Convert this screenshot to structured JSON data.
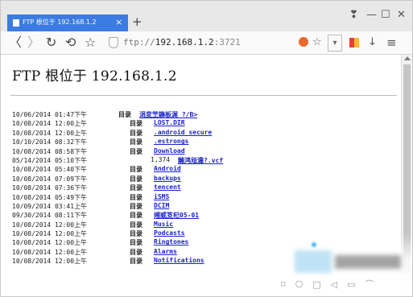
{
  "tab": {
    "title": "FTP 根位于 192.168.1.2",
    "close": "×"
  },
  "window_controls": {
    "pin": "❣",
    "minimize": "—",
    "maximize": "☐",
    "close": "✕"
  },
  "toolbar": {
    "back": "〈",
    "forward": "〉",
    "reload": "↻",
    "undo": "⟲",
    "bookmark": "☆",
    "new_tab": "+"
  },
  "address": {
    "scheme": "ftp://",
    "host": "192.168.1.2",
    "port": ":3721"
  },
  "page": {
    "title": "FTP 根位于 192.168.1.2",
    "entries": [
      {
        "date": "10/06/2014 01:47下午",
        "kind": "目录",
        "size": "",
        "name": "涓変笁鍦板浘 ?/B>"
      },
      {
        "date": "10/08/2014 12:00上午",
        "kind": "目录",
        "size": "",
        "name": "LOST.DIR"
      },
      {
        "date": "10/08/2014 12:00上午",
        "kind": "目录",
        "size": "",
        "name": ".android_secure"
      },
      {
        "date": "10/10/2014 08:32下午",
        "kind": "目录",
        "size": "",
        "name": ".estrongs"
      },
      {
        "date": "10/08/2014 08:58下午",
        "kind": "目录",
        "size": "",
        "name": "Download"
      },
      {
        "date": "05/14/2014 05:10下午",
        "kind": "",
        "size": "1,374",
        "name": "鏅鸿兘瀹?.vcf"
      },
      {
        "date": "10/08/2014 05:40下午",
        "kind": "目录",
        "size": "",
        "name": "Android"
      },
      {
        "date": "10/08/2014 07:09下午",
        "kind": "目录",
        "size": "",
        "name": "backups"
      },
      {
        "date": "10/08/2014 07:36下午",
        "kind": "目录",
        "size": "",
        "name": "tencent"
      },
      {
        "date": "10/08/2014 05:49下午",
        "kind": "目录",
        "size": "",
        "name": "iSMS"
      },
      {
        "date": "10/09/2014 03:41上午",
        "kind": "目录",
        "size": "",
        "name": "DCIM"
      },
      {
        "date": "09/30/2014 08:11下午",
        "kind": "目录",
        "size": "",
        "name": "缃戜笅杞05-01"
      },
      {
        "date": "10/08/2014 12:00上午",
        "kind": "目录",
        "size": "",
        "name": "Music"
      },
      {
        "date": "10/08/2014 12:00上午",
        "kind": "目录",
        "size": "",
        "name": "Podcasts"
      },
      {
        "date": "10/08/2014 12:00上午",
        "kind": "目录",
        "size": "",
        "name": "Ringtones"
      },
      {
        "date": "10/08/2014 12:00上午",
        "kind": "目录",
        "size": "",
        "name": "Alarms"
      },
      {
        "date": "10/08/2014 12:00上午",
        "kind": "目录",
        "size": "",
        "name": "Notifications"
      }
    ]
  },
  "colors": {
    "tab_active": "#3b7be3",
    "link": "#1a22c8"
  },
  "icons": [
    "page-icon",
    "shield-icon",
    "browser-badge-icon",
    "star-icon",
    "chevron-down-icon",
    "apps-icon",
    "download-icon",
    "menu-icon"
  ]
}
